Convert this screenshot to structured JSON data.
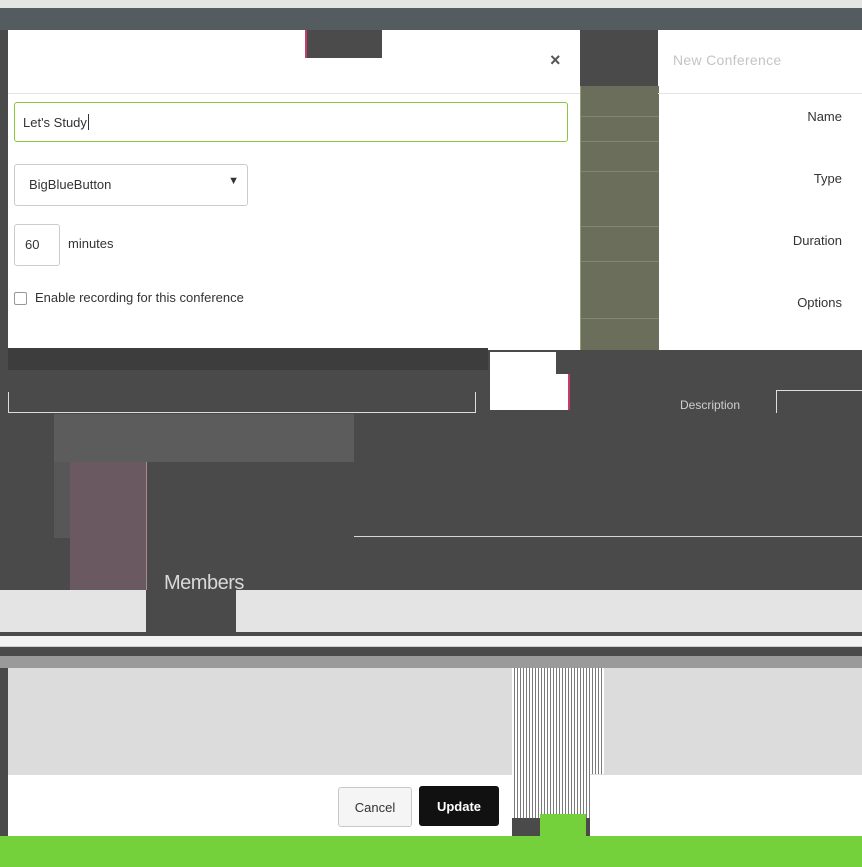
{
  "dialog": {
    "title": "New Conference",
    "close_glyph": "×"
  },
  "form": {
    "name": {
      "label": "Name",
      "value": "Let's Study"
    },
    "type": {
      "label": "Type",
      "selected": "BigBlueButton",
      "arrow": "▼"
    },
    "duration": {
      "label": "Duration",
      "value": "60",
      "unit": "minutes"
    },
    "options": {
      "label": "Options",
      "checkbox_label": "Enable recording for this conference",
      "checked": false
    },
    "description": {
      "label": "Description"
    },
    "members": {
      "heading": "Members"
    }
  },
  "footer": {
    "cancel_label": "Cancel",
    "update_label": "Update"
  },
  "colors": {
    "accent_green": "#75d13b",
    "input_focus": "#8cc63f",
    "primary_button": "#111111"
  }
}
